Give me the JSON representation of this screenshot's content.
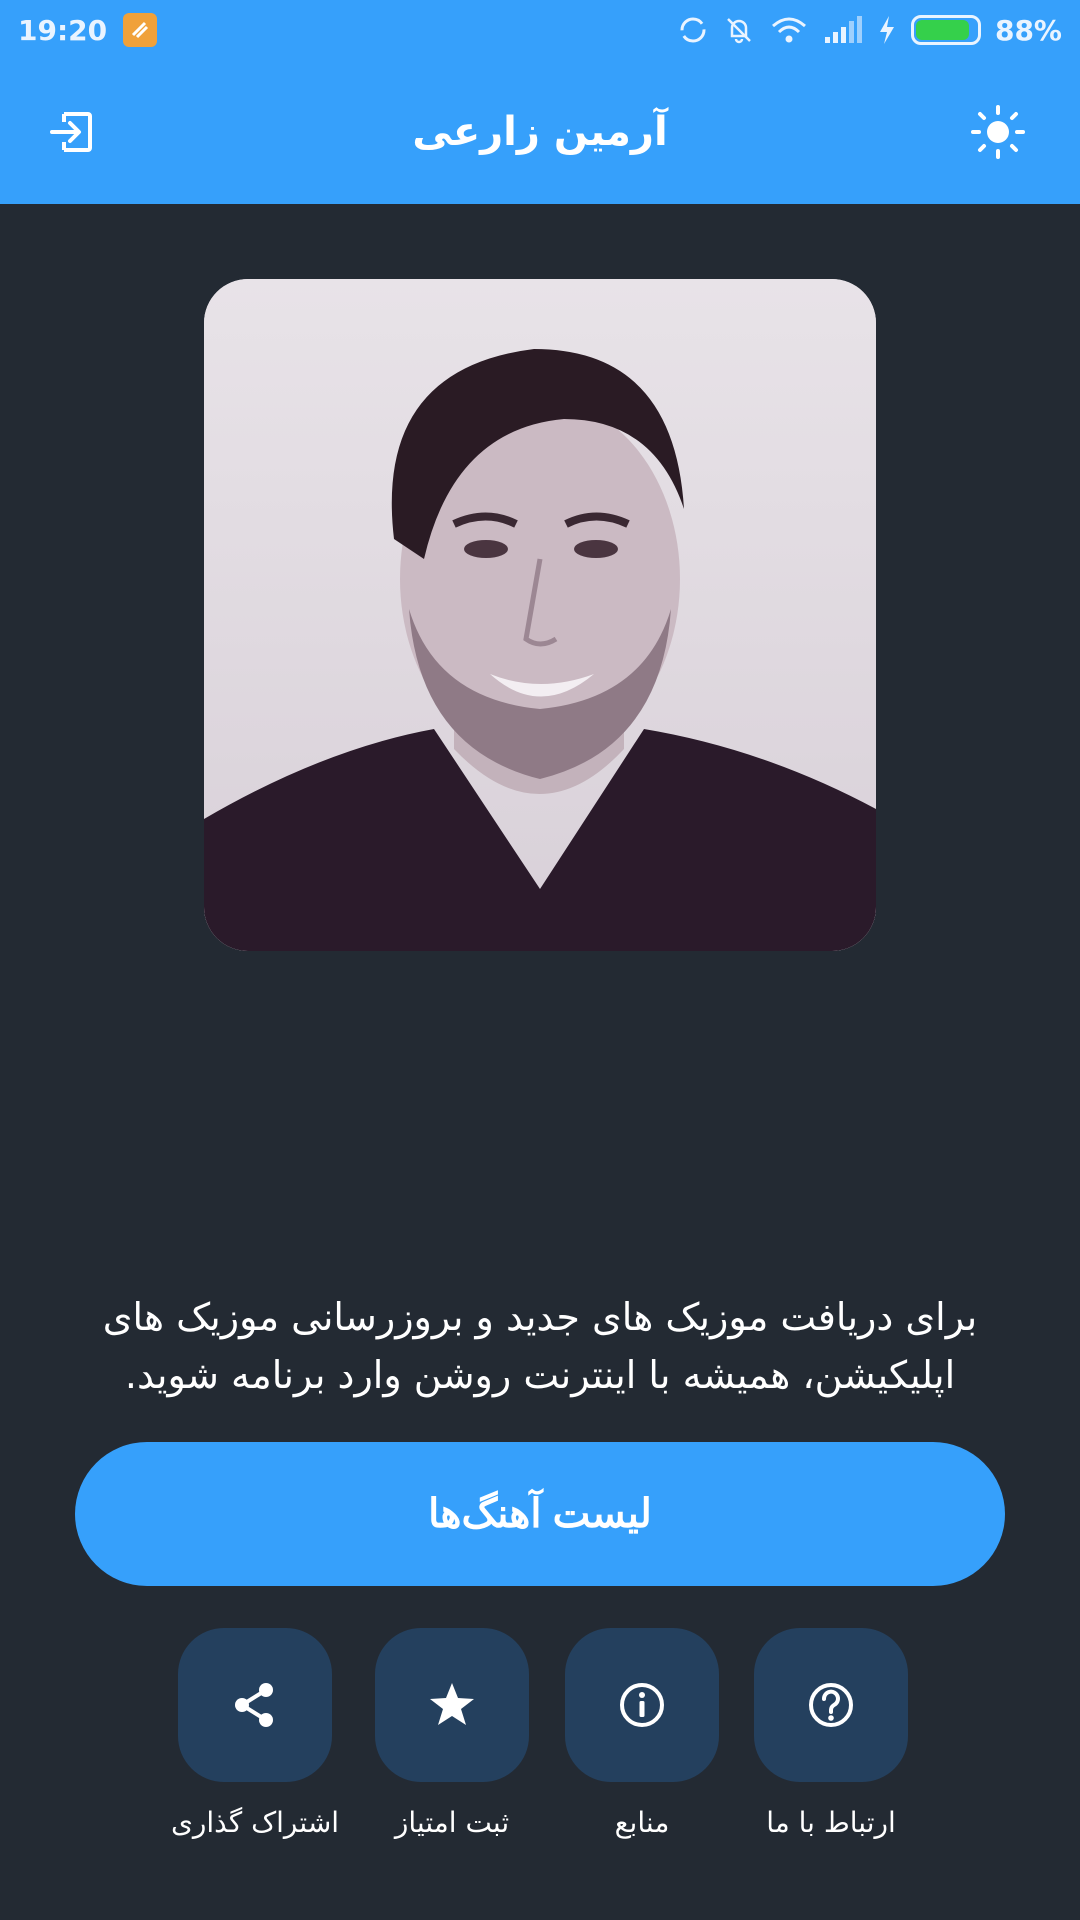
{
  "status_bar": {
    "time": "19:20",
    "battery_percent": "88%",
    "battery_level": 0.88,
    "icons": [
      "sync-icon",
      "bell-off-icon",
      "wifi-icon",
      "signal-icon",
      "charging-icon",
      "battery-icon"
    ]
  },
  "app_bar": {
    "title": "آرمین زارعی",
    "left_icon": "exit-icon",
    "right_icon": "sun-icon"
  },
  "info_text": "برای دریافت موزیک های جدید و بروزرسانی موزیک های اپلیکیشن، همیشه با اینترنت روشن وارد برنامه شوید.",
  "main_button": {
    "label": "لیست آهنگ‌ها"
  },
  "actions": [
    {
      "label": "اشتراک گذاری",
      "icon": "share-icon"
    },
    {
      "label": "ثبت امتیاز",
      "icon": "star-icon"
    },
    {
      "label": "منابع",
      "icon": "info-icon"
    },
    {
      "label": "ارتباط با ما",
      "icon": "help-icon"
    }
  ],
  "colors": {
    "primary": "#36a0fb",
    "background": "#232a33",
    "tile": "#24405e"
  }
}
